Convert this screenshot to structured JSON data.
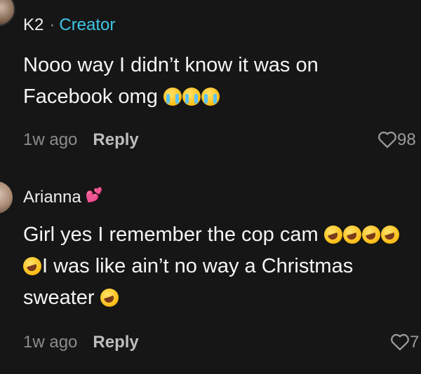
{
  "comments": [
    {
      "username": "K2",
      "separator": "·",
      "badge": "Creator",
      "lines": [
        "Nooo way I didn’t know it was on",
        "Facebook omg"
      ],
      "time": "1w ago",
      "reply_label": "Reply",
      "likes": "98"
    },
    {
      "username": "Arianna",
      "lines": [
        "Girl yes I remember the cop cam",
        "I was like ain’t no way a Christmas",
        "sweater"
      ],
      "time": "1w ago",
      "reply_label": "Reply",
      "likes": "7"
    }
  ],
  "colors": {
    "background": "#161616",
    "creator_badge": "#3fc6e6",
    "meta_text": "#8c8c8c"
  },
  "icons": [
    "heart-outline-icon",
    "loudly-crying-face-emoji",
    "rolling-on-floor-laughing-emoji",
    "two-hearts-emoji"
  ]
}
